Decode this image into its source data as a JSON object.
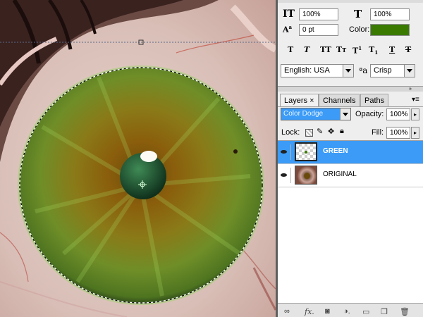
{
  "character_panel": {
    "vertical_scale": "100%",
    "horizontal_scale": "100%",
    "baseline_shift": "0 pt",
    "color_label": "Color:",
    "text_color": "#3a7a00",
    "language": "English: USA",
    "aa_method": "Crisp"
  },
  "layers_panel": {
    "tabs": [
      {
        "label": "Layers ×",
        "active": true
      },
      {
        "label": "Channels",
        "active": false
      },
      {
        "label": "Paths",
        "active": false
      }
    ],
    "blend_mode": "Color Dodge",
    "opacity_label": "Opacity:",
    "opacity": "100%",
    "lock_label": "Lock:",
    "fill_label": "Fill:",
    "fill": "100%",
    "layers": [
      {
        "name": "GREEN",
        "selected": true
      },
      {
        "name": "ORIGINAL",
        "selected": false
      }
    ],
    "selection_color": "#3b9bf7"
  },
  "icons": {
    "vertical_scale": "vertical-text-scale-icon",
    "horizontal_scale": "horizontal-text-scale-icon",
    "baseline": "baseline-shift-icon",
    "aa": "anti-alias-icon"
  }
}
